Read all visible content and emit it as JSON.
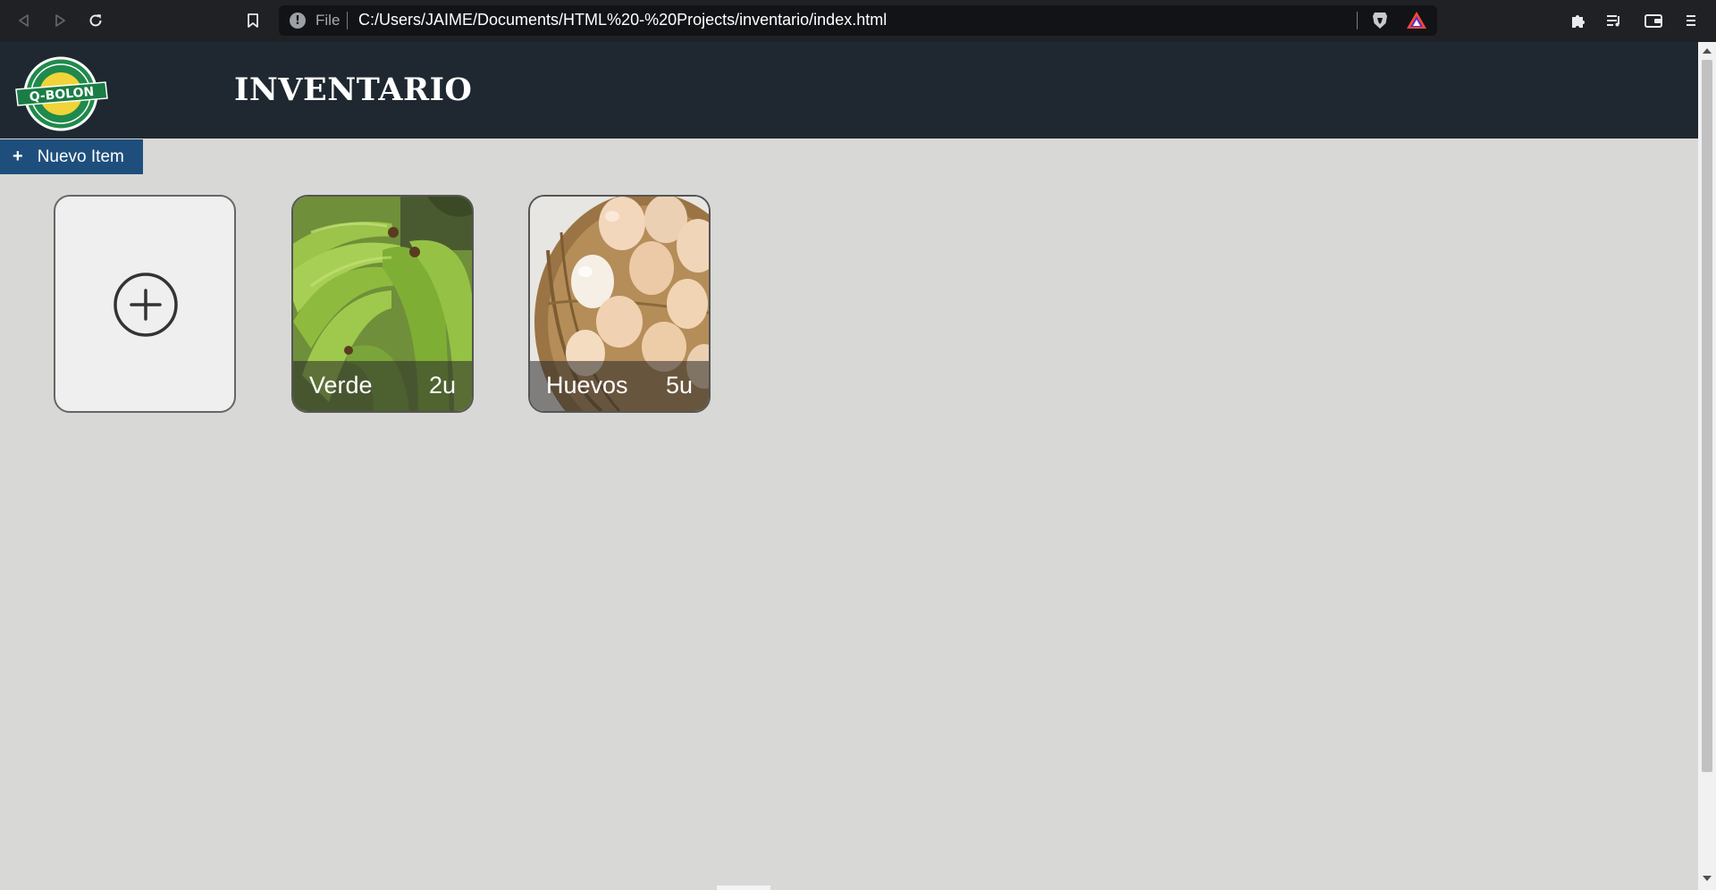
{
  "browser": {
    "scheme_label": "File",
    "url": "C:/Users/JAIME/Documents/HTML%20-%20Projects/inventario/index.html",
    "icons": [
      "back-icon",
      "forward-icon",
      "reload-icon",
      "bookmark-icon",
      "info-icon",
      "brave-shield-icon",
      "brave-rewards-icon",
      "extensions-icon",
      "media-icon",
      "wallet-icon",
      "menu-icon"
    ]
  },
  "app": {
    "title": "INVENTARIO",
    "logo_text": "Q-BOLON",
    "header_color": "#1f2830"
  },
  "toolbar": {
    "new_item_icon": "+",
    "new_item_label": "Nuevo Item",
    "button_color": "#1e4f7c"
  },
  "items": [
    {
      "name": "Verde",
      "qty": "2u",
      "image": "green-plantains"
    },
    {
      "name": "Huevos",
      "qty": "5u",
      "image": "eggs-in-basket"
    }
  ],
  "add_card": {
    "icon": "add-circle-icon"
  }
}
